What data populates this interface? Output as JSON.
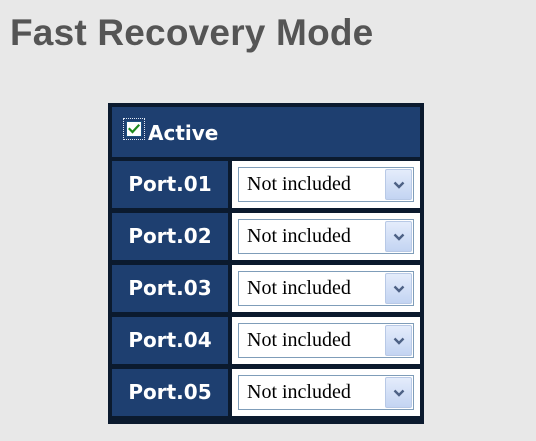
{
  "title": "Fast Recovery Mode",
  "active": {
    "label": "Active",
    "checked": true
  },
  "ports": [
    {
      "label": "Port.01",
      "value": "Not included"
    },
    {
      "label": "Port.02",
      "value": "Not included"
    },
    {
      "label": "Port.03",
      "value": "Not included"
    },
    {
      "label": "Port.04",
      "value": "Not included"
    },
    {
      "label": "Port.05",
      "value": "Not included"
    }
  ],
  "icons": {
    "checkbox_mark": "checkmark-icon",
    "dropdown": "chevron-down-icon"
  },
  "colors": {
    "header_bg": "#1e3f70",
    "panel_border": "#0b1a2e",
    "page_bg": "#e8e8e8",
    "title_text": "#555555",
    "check_mark": "#1d8a1d"
  }
}
